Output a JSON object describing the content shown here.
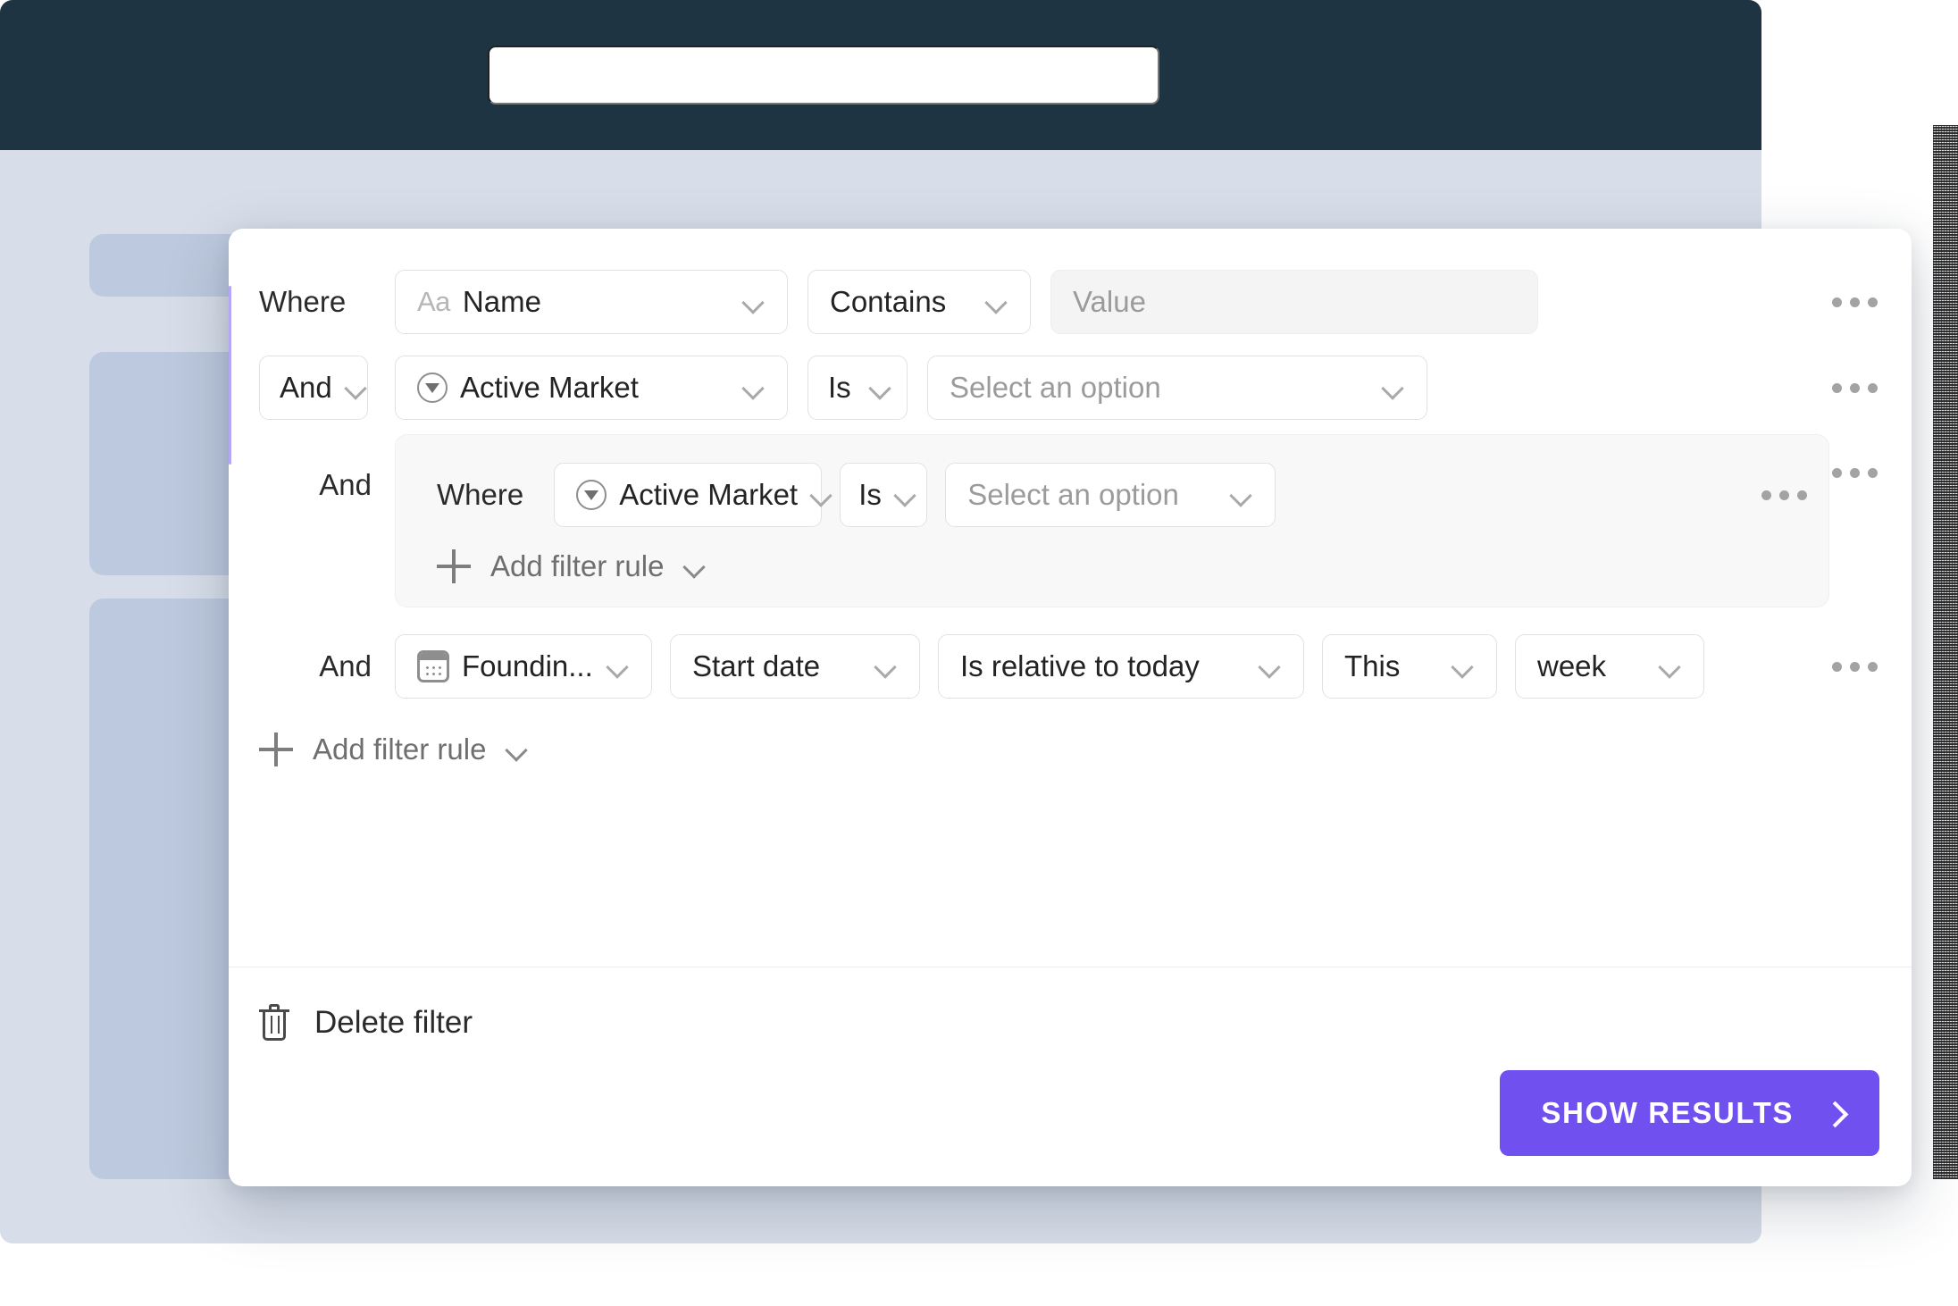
{
  "app": {
    "search_value": "",
    "search_placeholder": ""
  },
  "panel": {
    "rows": [
      {
        "connector": "Where",
        "connector_type": "static",
        "field": "Name",
        "field_icon": "text-aa-icon",
        "field_prefix": "Aa",
        "operator": "Contains",
        "value": "",
        "value_placeholder": "Value",
        "menu": "…"
      },
      {
        "connector": "And",
        "connector_type": "dropdown",
        "field": "Active Market",
        "field_icon": "select-property-icon",
        "operator": "Is",
        "value_placeholder": "Select an option",
        "menu": "…"
      }
    ],
    "nested_group": {
      "connector": "And",
      "row": {
        "label": "Where",
        "field": "Active Market",
        "field_icon": "select-property-icon",
        "operator": "Is",
        "value_placeholder": "Select an option",
        "menu": "…"
      },
      "add_rule_label": "Add filter rule",
      "menu": "…"
    },
    "date_row": {
      "connector": "And",
      "field": "Foundin...",
      "field_icon": "calendar-icon",
      "date_part": "Start date",
      "operator": "Is relative to today",
      "modifier": "This",
      "unit": "week",
      "menu": "…"
    },
    "add_rule_label": "Add filter rule",
    "delete_filter_label": "Delete filter",
    "show_results_label": "SHOW RESULTS"
  },
  "colors": {
    "accent": "#7050ef",
    "header_bg": "#1f3443",
    "app_bg": "#d7dee9",
    "ghost_block": "#bdc9de"
  }
}
